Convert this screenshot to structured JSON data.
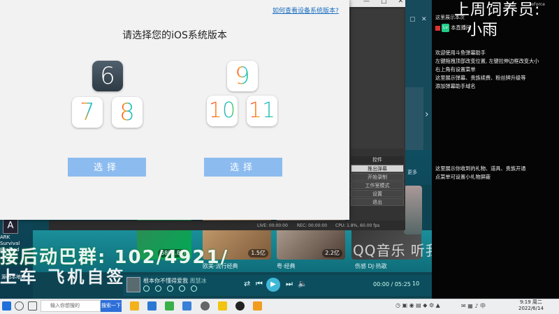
{
  "dialog": {
    "help_link": "如何查看设备系统版本?",
    "title": "请选择您的iOS系统版本",
    "versions_left": [
      "6",
      "7",
      "8"
    ],
    "versions_right": [
      "9",
      "10",
      "11"
    ],
    "select_left": "选择",
    "select_right": "选择"
  },
  "recorder": {
    "menu_head": "控件",
    "menu_items": [
      "推出弹幕",
      "开始录制",
      "工作室模式",
      "设置",
      "退出"
    ],
    "status": [
      "LIVE: 00:00:00",
      "REC: 00:00:00",
      "CPU: 1.8%, 60.00 fps"
    ]
  },
  "stream": {
    "title_line1": "上周饲养员:",
    "title_line2": "小雨",
    "small_top": "这里展示本次",
    "small_right": "eForce",
    "fans_line": "本直播间",
    "tips": [
      "欢迎使用斗鱼弹幕助手",
      "左键拖拽顶部改变位置, 左键拉伸边框改变大小",
      "右上角有设置菜单",
      "这里展示弹幕、贵族续费、粉丝牌升级等",
      "添加弹幕助手域名"
    ],
    "gift_tips": [
      "这里展示你收到的礼物、道具、贵族开通",
      "点菜单可设置小礼物屏蔽"
    ],
    "side_label": "更多"
  },
  "music": {
    "thumbs": [
      {
        "count": "6801.8万",
        "caption": ""
      },
      {
        "count": "1.5亿",
        "caption": "欧美·流行经典"
      },
      {
        "count": "2.2亿",
        "caption": "粤·经典"
      },
      {
        "count": "",
        "caption": "伤感 DJ·热歌"
      }
    ],
    "banner": "QQ音乐 听我想听",
    "overlay_line1": "接后动巴群: 102/4921/",
    "overlay_line2": "上车   飞机自签",
    "now_playing_title": "根本你不懂得爱我",
    "now_playing_artist": "周慧冰",
    "time": "00:00 / 05:25",
    "playlist_count": "10"
  },
  "desktop": {
    "icon_label": "ARK Survival Evolved",
    "icon2_label": "源码本地库"
  },
  "taskbar": {
    "search_placeholder": "输入你想搜的",
    "search_button": "搜索一下",
    "time": "9:19 周二",
    "date": "2022/6/14"
  }
}
